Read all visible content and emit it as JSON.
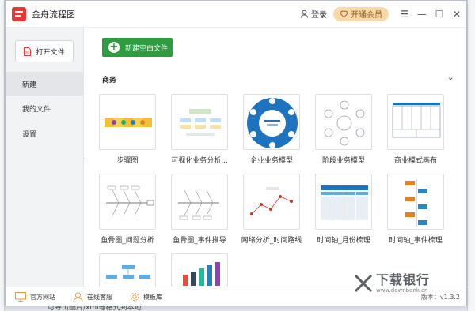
{
  "app": {
    "title": "金舟流程图"
  },
  "titlebar": {
    "login_label": "登录",
    "vip_label": "开通会员"
  },
  "sidebar": {
    "open_file_label": "打开文件",
    "items": [
      {
        "label": "新建",
        "active": true
      },
      {
        "label": "我的文件",
        "active": false
      },
      {
        "label": "设置",
        "active": false
      }
    ]
  },
  "main": {
    "new_blank_label": "新建空白文件",
    "section_title": "商务",
    "templates": [
      {
        "label": "步骤图"
      },
      {
        "label": "可视化业务分析..."
      },
      {
        "label": "企业业务模型"
      },
      {
        "label": "阶段业务模型"
      },
      {
        "label": "商业模式画布"
      },
      {
        "label": "鱼骨图_问题分析"
      },
      {
        "label": "鱼骨图_事件推导"
      },
      {
        "label": "网络分析_时间路线"
      },
      {
        "label": "时间轴_月份梳理"
      },
      {
        "label": "时间轴_事件梳理"
      },
      {
        "label": ""
      },
      {
        "label": ""
      }
    ]
  },
  "footer": {
    "items": [
      {
        "label": "官方网站",
        "icon": "monitor-icon"
      },
      {
        "label": "在线客服",
        "icon": "headset-icon"
      },
      {
        "label": "模板库",
        "icon": "gear-icon"
      }
    ],
    "version": "版本：v1.3.2"
  },
  "watermark": {
    "main": "下载银行",
    "sub": "www.downbank.cn"
  },
  "background": {
    "bottom_text": "可导出图片/xml等格式到本地"
  },
  "colors": {
    "accent_green": "#2e9d3f",
    "logo_red": "#e53935",
    "vip_gold": "#f8d9a8"
  }
}
